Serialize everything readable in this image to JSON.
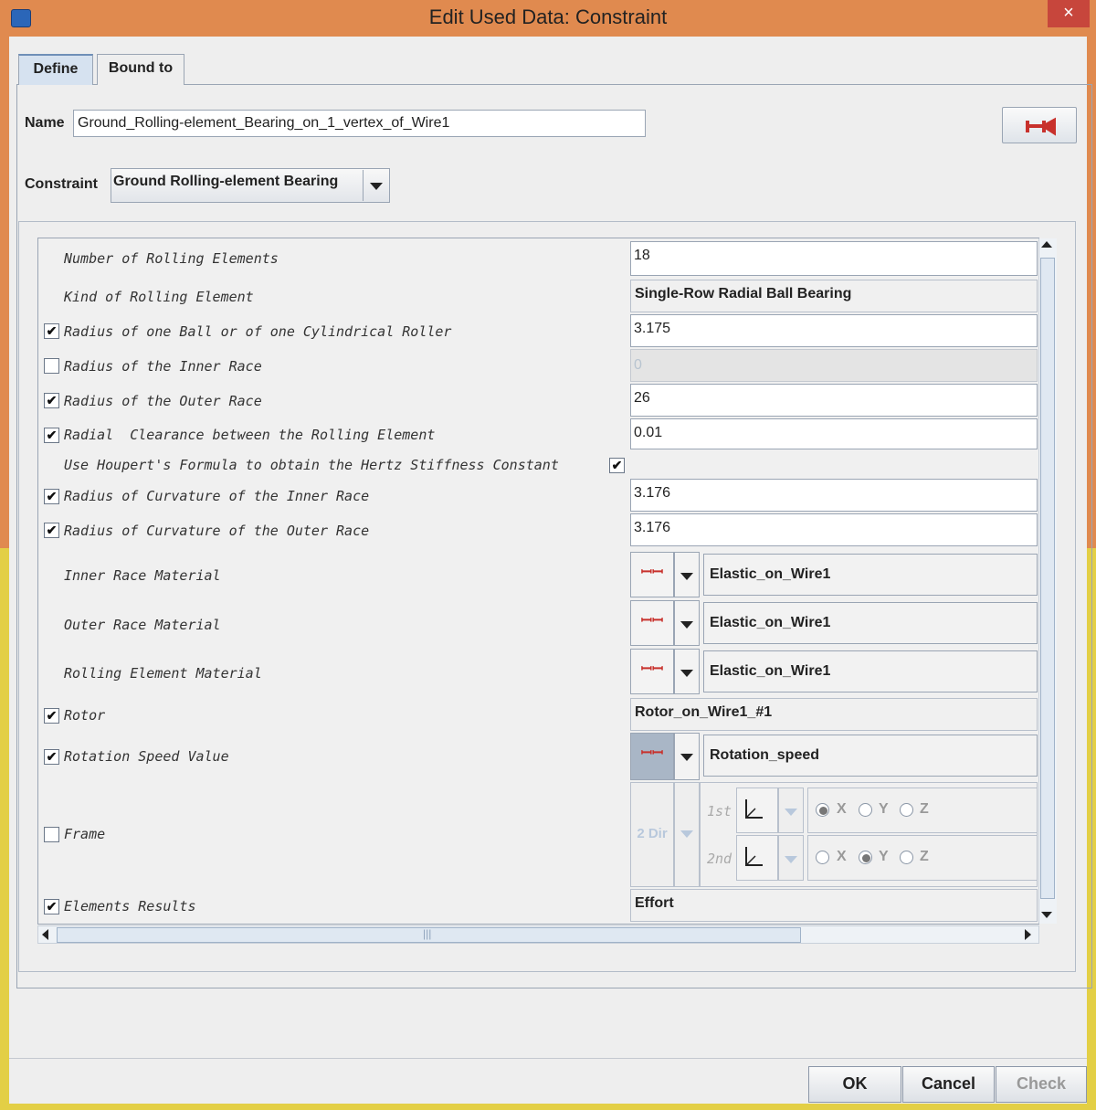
{
  "window": {
    "title": "Edit Used Data: Constraint",
    "close_glyph": "×"
  },
  "tabs": [
    {
      "label": "Define",
      "selected": true
    },
    {
      "label": "Bound to",
      "selected": false
    }
  ],
  "form": {
    "name_label": "Name",
    "name_value": "Ground_Rolling-element_Bearing_on_1_vertex_of_Wire1",
    "constraint_label": "Constraint",
    "constraint_value": "Ground Rolling-element Bearing",
    "tool_icon": "pin-icon"
  },
  "rows": {
    "num_rolling": {
      "label": "Number of Rolling Elements",
      "value": "18"
    },
    "kind": {
      "label": "Kind of Rolling Element",
      "value": "Single-Row Radial Ball Bearing"
    },
    "ball_radius": {
      "label": "Radius of one Ball or of one Cylindrical Roller",
      "value": "3.175",
      "checked": true
    },
    "inner_radius": {
      "label": "Radius of the Inner Race",
      "value": "0",
      "checked": false
    },
    "outer_radius": {
      "label": "Radius of the Outer Race",
      "value": "26",
      "checked": true
    },
    "clearance": {
      "label": "Radial  Clearance between the Rolling Element",
      "value": "0.01",
      "checked": true
    },
    "houpert": {
      "label": "Use Houpert's Formula to obtain the Hertz Stiffness Constant",
      "checked": true
    },
    "curv_inner": {
      "label": "Radius of Curvature of the Inner Race",
      "value": "3.176",
      "checked": true
    },
    "curv_outer": {
      "label": "Radius of Curvature of the Outer Race",
      "value": "3.176",
      "checked": true
    },
    "inner_mat": {
      "label": "Inner Race Material",
      "value": "Elastic_on_Wire1"
    },
    "outer_mat": {
      "label": "Outer Race Material",
      "value": "Elastic_on_Wire1"
    },
    "roll_mat": {
      "label": "Rolling Element Material",
      "value": "Elastic_on_Wire1"
    },
    "rotor": {
      "label": "Rotor",
      "value": "Rotor_on_Wire1_#1",
      "checked": true
    },
    "speed": {
      "label": "Rotation Speed Value",
      "value": "Rotation_speed",
      "checked": true
    },
    "frame": {
      "label": "Frame",
      "checked": false,
      "mode": "2 Dir",
      "first": {
        "label": "1st",
        "x": "X",
        "y": "Y",
        "z": "Z",
        "selected": "X"
      },
      "second": {
        "label": "2nd",
        "x": "X",
        "y": "Y",
        "z": "Z",
        "selected": "Y"
      }
    },
    "results": {
      "label": "Elements Results",
      "value": "Effort",
      "checked": true
    }
  },
  "link_glyph": "ꟷꟷ",
  "buttons": {
    "ok": "OK",
    "cancel": "Cancel",
    "check": "Check"
  },
  "scroll": {
    "h_grip": "|||"
  }
}
